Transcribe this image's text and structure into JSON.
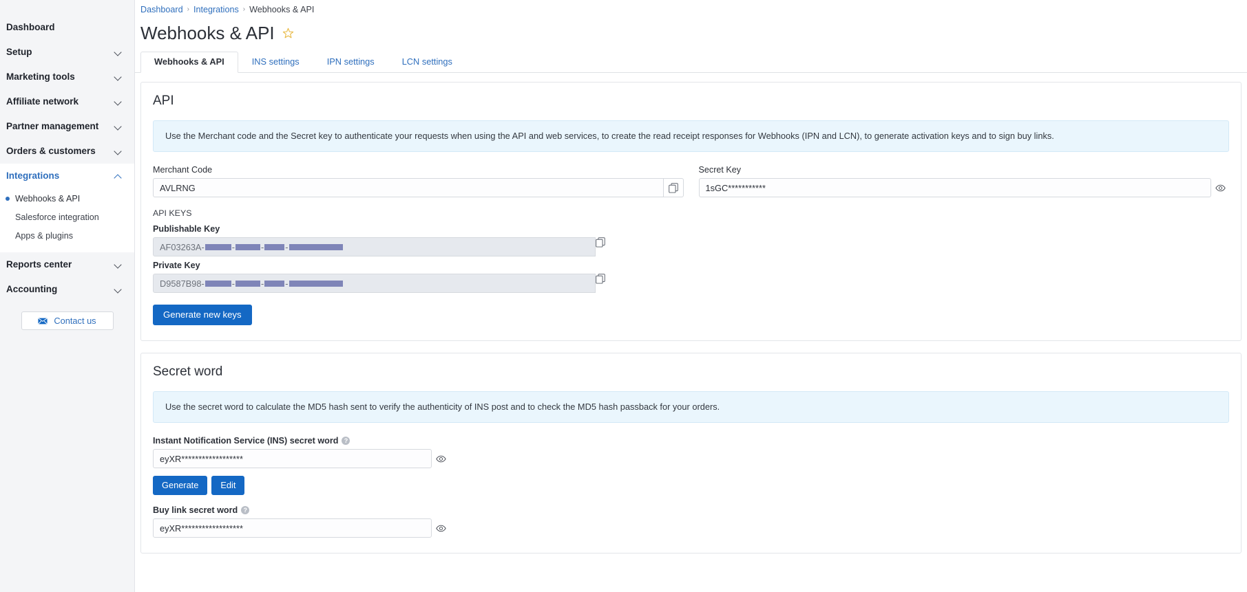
{
  "sidebar": {
    "items": [
      {
        "label": "Dashboard",
        "expandable": false,
        "state": ""
      },
      {
        "label": "Setup",
        "expandable": true,
        "state": "collapsed"
      },
      {
        "label": "Marketing tools",
        "expandable": true,
        "state": "collapsed"
      },
      {
        "label": "Affiliate network",
        "expandable": true,
        "state": "collapsed"
      },
      {
        "label": "Partner management",
        "expandable": true,
        "state": "collapsed"
      },
      {
        "label": "Orders & customers",
        "expandable": true,
        "state": "collapsed"
      },
      {
        "label": "Integrations",
        "expandable": true,
        "state": "expanded"
      },
      {
        "label": "Reports center",
        "expandable": true,
        "state": "collapsed"
      },
      {
        "label": "Accounting",
        "expandable": true,
        "state": "collapsed"
      }
    ],
    "integrations_children": [
      {
        "label": "Webhooks & API",
        "current": true
      },
      {
        "label": "Salesforce integration",
        "current": false
      },
      {
        "label": "Apps & plugins",
        "current": false
      }
    ],
    "contact_button": "Contact us",
    "contact_icon": "envelope-icon"
  },
  "breadcrumb": {
    "items": [
      "Dashboard",
      "Integrations",
      "Webhooks & API"
    ],
    "separator": "›"
  },
  "header": {
    "title": "Webhooks & API",
    "favorite_icon": "star-icon"
  },
  "tabs": [
    {
      "label": "Webhooks & API",
      "active": true
    },
    {
      "label": "INS settings",
      "active": false
    },
    {
      "label": "IPN settings",
      "active": false
    },
    {
      "label": "LCN settings",
      "active": false
    }
  ],
  "api_section": {
    "title": "API",
    "info": "Use the Merchant code and the Secret key to authenticate your requests when using the API and web services, to create the read receipt responses for Webhooks (IPN and LCN), to generate activation keys and to sign buy links.",
    "merchant_code": {
      "label": "Merchant Code",
      "value": "AVLRNG",
      "copy_icon": "copy-icon"
    },
    "secret_key": {
      "label": "Secret Key",
      "value": "1sGC***********",
      "reveal_icon": "eye-icon"
    },
    "api_keys_label": "API KEYS",
    "publishable_key": {
      "label": "Publishable Key",
      "prefix": "AF03263A-",
      "copy_icon": "copy-icon"
    },
    "private_key": {
      "label": "Private Key",
      "prefix": "D9587B98-",
      "copy_icon": "copy-icon"
    },
    "generate_keys_button": "Generate new keys"
  },
  "secret_word_section": {
    "title": "Secret word",
    "info": "Use the secret word to calculate the MD5 hash sent to verify the authenticity of INS post and to check the MD5 hash passback for your orders.",
    "ins": {
      "label": "Instant Notification Service (INS) secret word",
      "help_icon": "question-mark-icon",
      "value": "eyXR******************",
      "reveal_icon": "eye-icon",
      "generate_button": "Generate",
      "edit_button": "Edit"
    },
    "buy_link": {
      "label": "Buy link secret word",
      "help_icon": "question-mark-icon",
      "value": "eyXR******************",
      "reveal_icon": "eye-icon"
    }
  },
  "colors": {
    "accent": "#1468c4",
    "link": "#2f6fbd",
    "info_bg": "#eaf6fd",
    "redaction": "#7f85b8",
    "sidebar_bg": "#f4f5f7"
  }
}
